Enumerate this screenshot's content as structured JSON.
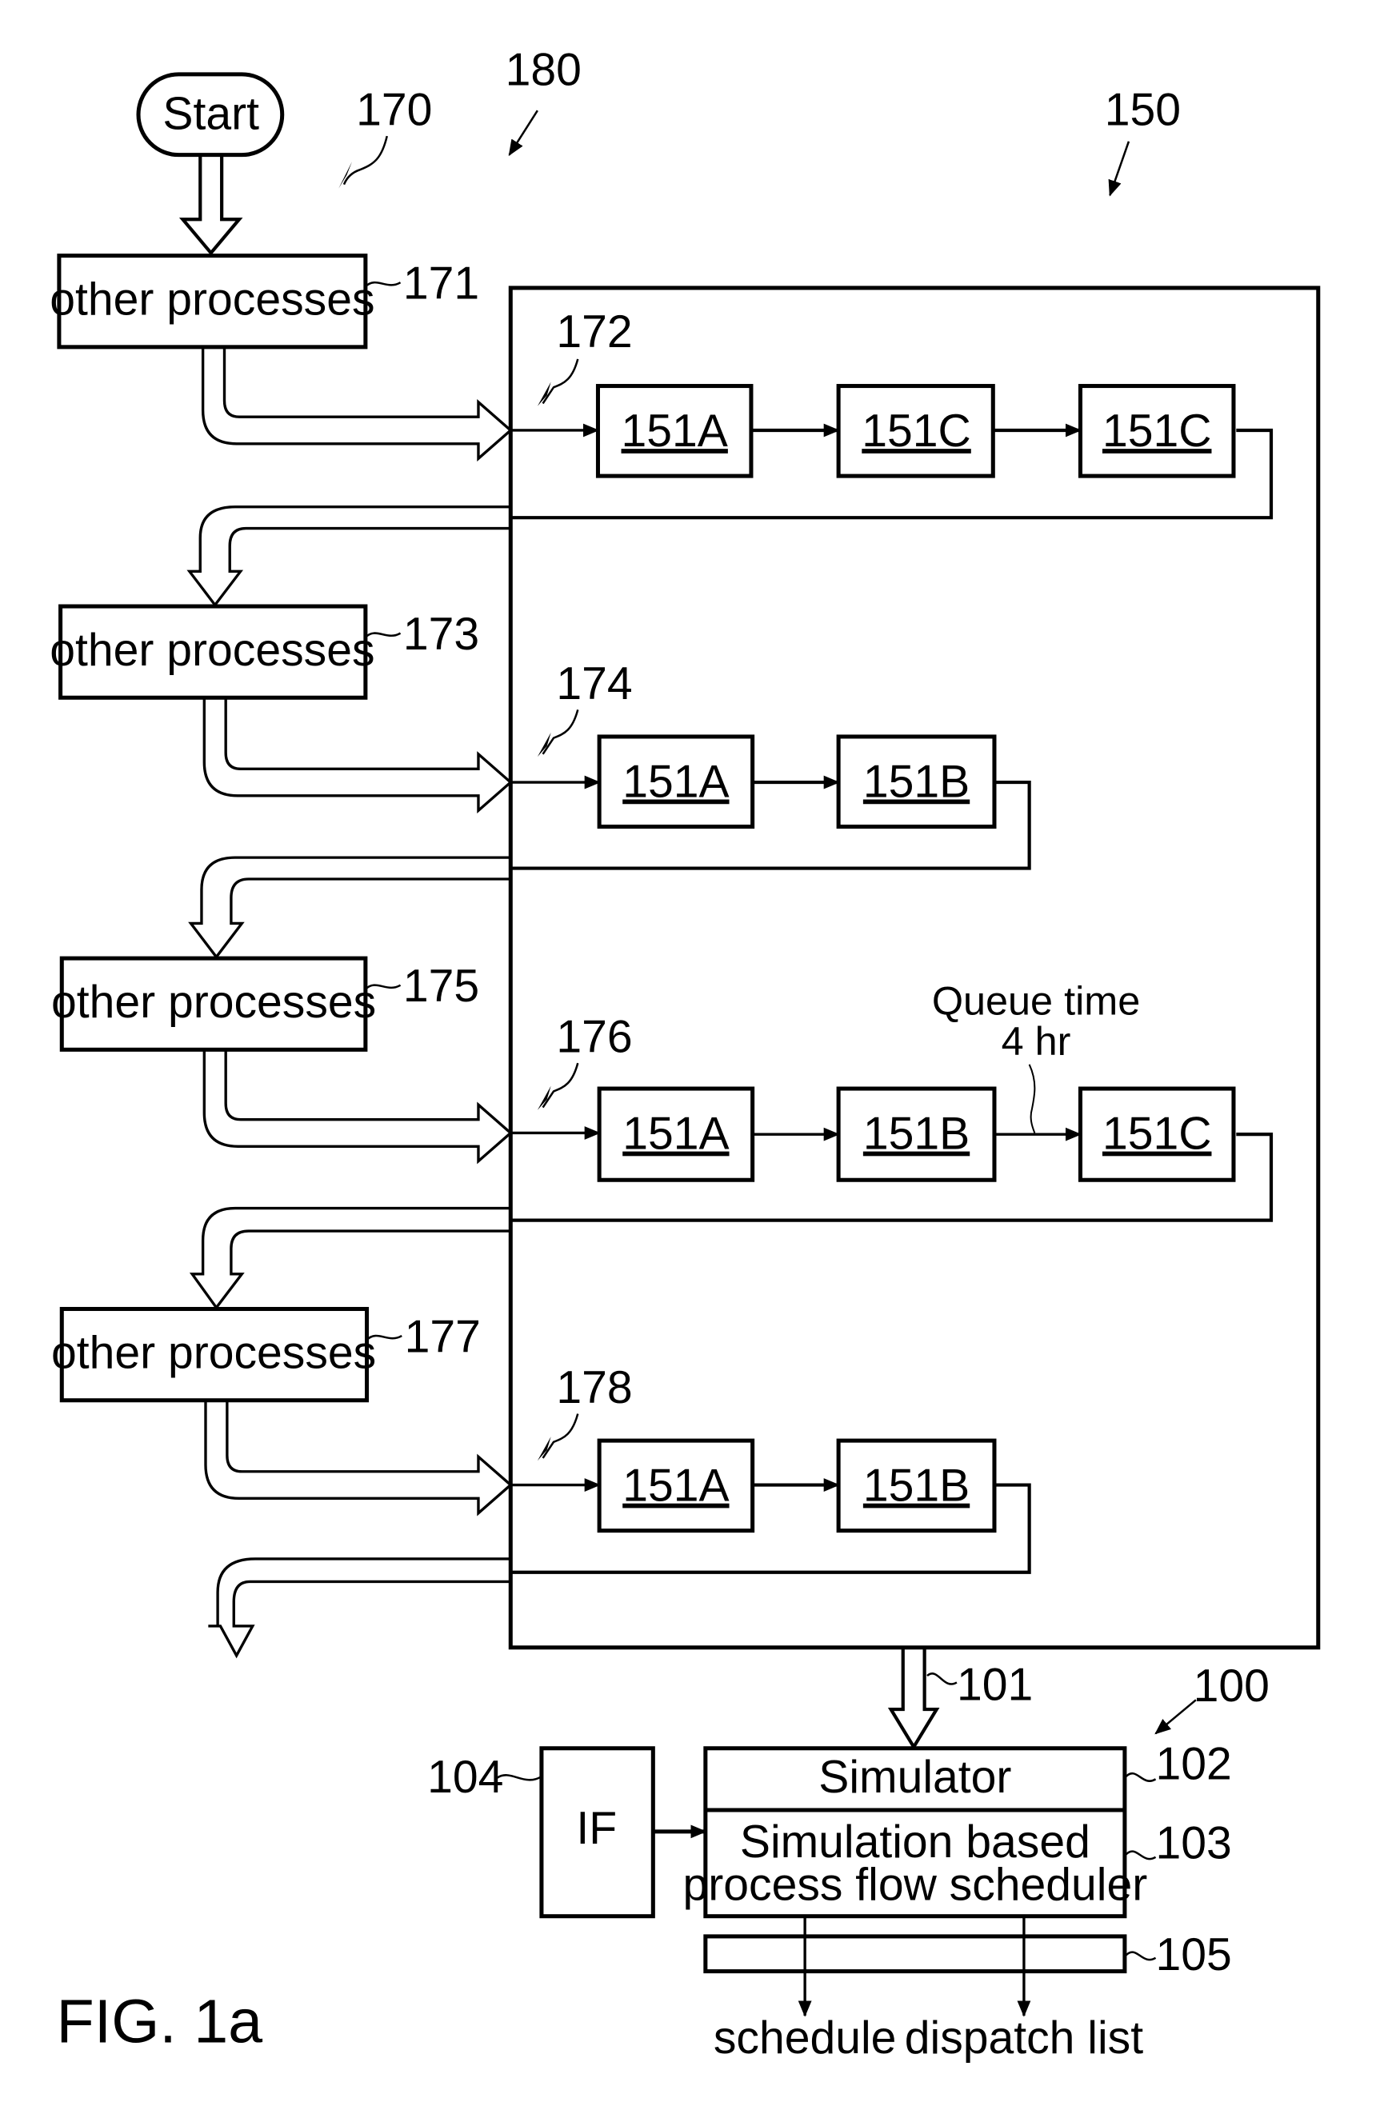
{
  "figure": {
    "caption": "FIG. 1a",
    "start_label": "Start",
    "refs": {
      "r170": "170",
      "r180": "180",
      "r150": "150",
      "r100": "100",
      "r101": "101",
      "r102": "102",
      "r103": "103",
      "r104": "104",
      "r105": "105"
    },
    "other_processes": [
      {
        "label": "other processes",
        "ref": "171"
      },
      {
        "label": "other processes",
        "ref": "173"
      },
      {
        "label": "other processes",
        "ref": "175"
      },
      {
        "label": "other processes",
        "ref": "177"
      }
    ],
    "routes": [
      {
        "ref": "172",
        "steps": [
          "151A",
          "151C",
          "151C"
        ]
      },
      {
        "ref": "174",
        "steps": [
          "151A",
          "151B"
        ]
      },
      {
        "ref": "176",
        "steps": [
          "151A",
          "151B",
          "151C"
        ],
        "annotation": [
          "Queue time",
          "4 hr"
        ]
      },
      {
        "ref": "178",
        "steps": [
          "151A",
          "151B"
        ]
      }
    ],
    "system": {
      "simulator_label": "Simulator",
      "scheduler_label_line1": "Simulation based",
      "scheduler_label_line2": "process flow scheduler",
      "interface_label": "IF",
      "outputs": [
        "schedule",
        "dispatch list"
      ]
    }
  }
}
